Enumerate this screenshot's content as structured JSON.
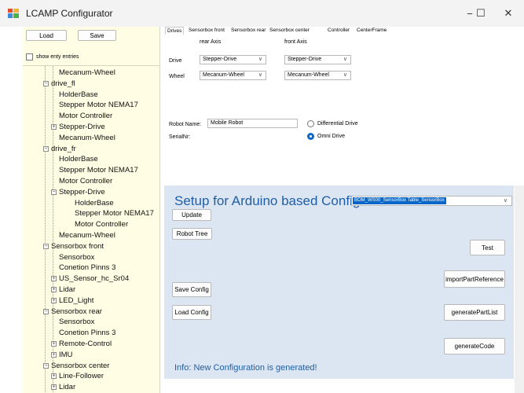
{
  "window": {
    "title": "LCAMP Configurator",
    "minimize": "−",
    "maximize": "☐",
    "close": "✕"
  },
  "left": {
    "load_label": "Load",
    "save_label": "Save",
    "show_empty_label": "show enty entries",
    "show_empty_checked": false
  },
  "tree": [
    {
      "text": "Mecanum-Wheel",
      "level": 2,
      "expander": ""
    },
    {
      "text": "drive_fl",
      "level": 1,
      "expander": "−"
    },
    {
      "text": "HolderBase",
      "level": 2,
      "expander": ""
    },
    {
      "text": "Stepper Motor NEMA17",
      "level": 2,
      "expander": ""
    },
    {
      "text": "Motor Controller",
      "level": 2,
      "expander": ""
    },
    {
      "text": "Stepper-Drive",
      "level": 2,
      "expander": "+"
    },
    {
      "text": "Mecanum-Wheel",
      "level": 2,
      "expander": ""
    },
    {
      "text": "drive_fr",
      "level": 1,
      "expander": "−"
    },
    {
      "text": "HolderBase",
      "level": 2,
      "expander": ""
    },
    {
      "text": "Stepper Motor NEMA17",
      "level": 2,
      "expander": ""
    },
    {
      "text": "Motor Controller",
      "level": 2,
      "expander": ""
    },
    {
      "text": "Stepper-Drive",
      "level": 2,
      "expander": "−"
    },
    {
      "text": "HolderBase",
      "level": 3,
      "expander": ""
    },
    {
      "text": "Stepper Motor NEMA17",
      "level": 3,
      "expander": ""
    },
    {
      "text": "Motor Controller",
      "level": 3,
      "expander": ""
    },
    {
      "text": "Mecanum-Wheel",
      "level": 2,
      "expander": ""
    },
    {
      "text": "Sensorbox front",
      "level": 1,
      "expander": "−"
    },
    {
      "text": "Sensorbox",
      "level": 2,
      "expander": ""
    },
    {
      "text": "Conetion Pinns 3",
      "level": 2,
      "expander": ""
    },
    {
      "text": "US_Sensor_hc_Sr04",
      "level": 2,
      "expander": "+"
    },
    {
      "text": "Lidar",
      "level": 2,
      "expander": "+"
    },
    {
      "text": "LED_Light",
      "level": 2,
      "expander": "+"
    },
    {
      "text": "Sensorbox rear",
      "level": 1,
      "expander": "−"
    },
    {
      "text": "Sensorbox",
      "level": 2,
      "expander": ""
    },
    {
      "text": "Conetion Pinns 3",
      "level": 2,
      "expander": ""
    },
    {
      "text": "Remote-Control",
      "level": 2,
      "expander": "+"
    },
    {
      "text": "IMU",
      "level": 2,
      "expander": "+"
    },
    {
      "text": "Sensorbox center",
      "level": 1,
      "expander": "−"
    },
    {
      "text": "Line-Follower",
      "level": 2,
      "expander": "+"
    },
    {
      "text": "Lidar",
      "level": 2,
      "expander": "+"
    }
  ],
  "tabs": [
    "Drives",
    "Sensorbox front",
    "Sensorbox rear",
    "Sensorbox center",
    "Controller",
    "CenterFrame"
  ],
  "drives": {
    "rear_axis_label": "rear Axis",
    "front_axis_label": "front Axis",
    "drive_label": "Drive",
    "wheel_label": "Wheel",
    "rear_drive": "Stepper-Drive",
    "front_drive": "Stepper-Drive",
    "rear_wheel": "Mecanum-Wheel",
    "front_wheel": "Mecanum-Wheel",
    "robot_name_label": "Robot Name:",
    "robot_name_value": "Mobile Robot",
    "serial_label": "SerialNr:",
    "differential_label": "Differential Drive",
    "omni_label": "Omni Drive",
    "selected_drive_type": "Omni Drive"
  },
  "setup": {
    "title": "Setup for Arduino based Configu",
    "combo_value": "BOM_WS00_SensorBox Table_SensorBox",
    "update_label": "Update",
    "robot_tree_label": "Robot Tree",
    "test_label": "Test",
    "import_label": "importPartReference",
    "save_config_label": "Save Config",
    "load_config_label": "Load Config",
    "generate_partlist_label": "generatePartList",
    "generate_code_label": "generateCode",
    "info": "Info: New Configuration is generated!"
  },
  "colors": {
    "tree_bg": "#fffde3",
    "setup_bg": "#dce6f2",
    "accent": "#1f5ea5",
    "selection": "#0a67c8"
  }
}
